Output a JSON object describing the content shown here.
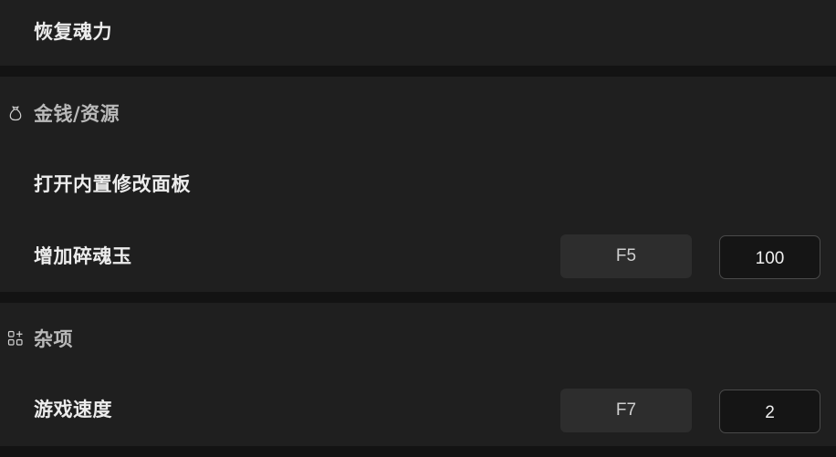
{
  "top_item": {
    "label": "恢复魂力"
  },
  "sections": {
    "money": {
      "title": "金钱/资源",
      "icon": "money-bag-icon",
      "items": [
        {
          "label": "打开内置修改面板"
        },
        {
          "label": "增加碎魂玉",
          "hotkey": "F5",
          "value": "100"
        }
      ]
    },
    "misc": {
      "title": "杂项",
      "icon": "apps-add-icon",
      "items": [
        {
          "label": "游戏速度",
          "hotkey": "F7",
          "value": "2"
        }
      ]
    }
  },
  "colors": {
    "background": "#131313",
    "panel": "#1f1f1f",
    "button": "#2d2d2d",
    "input_bg": "#151515",
    "input_border": "#4a4a4a",
    "text": "#ececec",
    "section_title": "#b9b9b9"
  }
}
